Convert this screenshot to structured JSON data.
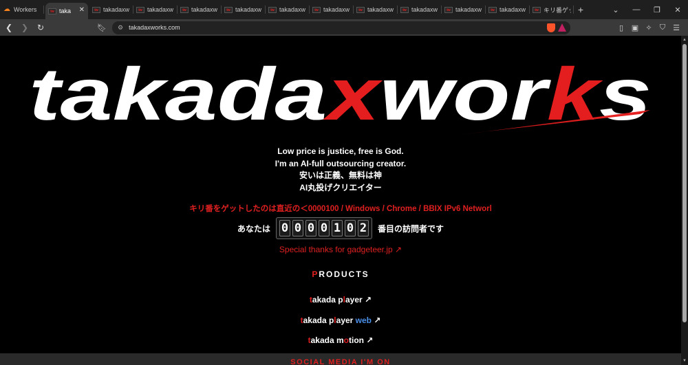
{
  "browser": {
    "tabs": [
      {
        "label": "Workers",
        "favicon": "cloudflare-icon"
      },
      {
        "label": "taka",
        "favicon": "tw-icon",
        "active": true
      },
      {
        "label": "takadaxw",
        "favicon": "tw-icon"
      },
      {
        "label": "takadaxw",
        "favicon": "tw-icon"
      },
      {
        "label": "takadaxw",
        "favicon": "tw-icon"
      },
      {
        "label": "takadaxw",
        "favicon": "tw-icon"
      },
      {
        "label": "takadaxw",
        "favicon": "tw-icon"
      },
      {
        "label": "takadaxw",
        "favicon": "tw-icon"
      },
      {
        "label": "takadaxw",
        "favicon": "tw-icon"
      },
      {
        "label": "takadaxw",
        "favicon": "tw-icon"
      },
      {
        "label": "takadaxw",
        "favicon": "tw-icon"
      },
      {
        "label": "takadaxw",
        "favicon": "tw-icon"
      },
      {
        "label": "キリ番ゲッ",
        "favicon": "tw-icon"
      }
    ],
    "favicon_text": "tw",
    "tab_close": "✕",
    "new_tab": "+",
    "url": "takadaxworks.com"
  },
  "page": {
    "logo": {
      "parts": [
        "taka",
        "da",
        "x",
        "wor",
        "k",
        "s"
      ],
      "colors": {
        "white": "#ffffff",
        "red": "#e41e1e"
      }
    },
    "taglines": [
      "Low price is justice, free is God.",
      "I'm an AI-full outsourcing creator.",
      "安いは正義、無料は神",
      "AI丸投げクリエイター"
    ],
    "kiriban": "キリ番をゲットしたのは直近の＜0000100 / Windows / Chrome / BBIX IPv6 Networl",
    "counter": {
      "prefix": "あなたは",
      "digits": [
        "0",
        "0",
        "0",
        "0",
        "1",
        "0",
        "2"
      ],
      "suffix": "番目の訪問者です"
    },
    "thanks": "Special thanks for gadgeteer.jp ↗",
    "products": {
      "heading_first": "P",
      "heading_rest": "RODUCTS",
      "items": [
        {
          "a": "t",
          "b": "akada p",
          "c": "l",
          "d": "ayer",
          "e": "",
          "arrow": " ↗"
        },
        {
          "a": "t",
          "b": "akada p",
          "c": "l",
          "d": "ayer ",
          "e": "web",
          "arrow": " ↗"
        },
        {
          "a": "t",
          "b": "akada m",
          "c": "o",
          "d": "tion",
          "e": "",
          "arrow": " ↗"
        }
      ]
    },
    "social_heading": "SOCIAL MEDIA I'M ON",
    "colors": {
      "accent_red": "#e02020",
      "link_blue": "#4a8fe8",
      "background": "#000000"
    }
  }
}
